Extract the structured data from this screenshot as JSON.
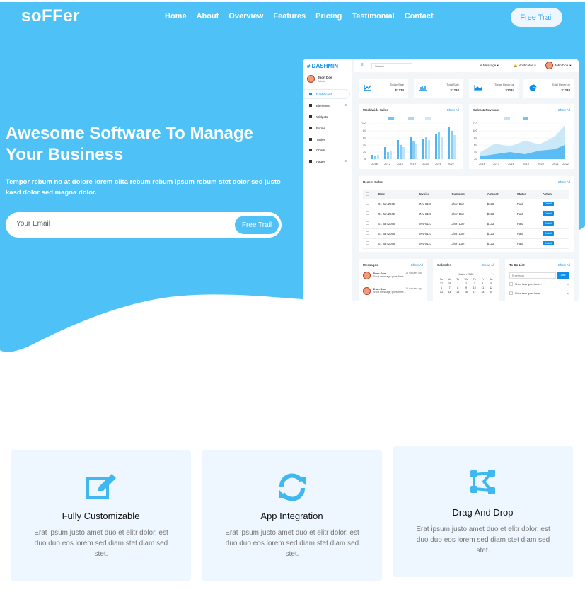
{
  "brand": "soFFer",
  "nav": {
    "items": [
      "Home",
      "About",
      "Overview",
      "Features",
      "Pricing",
      "Testimonial",
      "Contact"
    ],
    "cta": "Free Trail"
  },
  "hero": {
    "title": "Awesome Software To Manage Your Business",
    "subtitle": "Tempor rebum no at dolore lorem clita rebum rebum ipsum rebum stet dolor sed justo kasd dolor sed magna dolor.",
    "email_placeholder": "Your Email",
    "button": "Free Trail"
  },
  "dashboard": {
    "logo": "# DASHMIN",
    "user_name": "Jhon Doe",
    "user_role": "Admin",
    "sidebar": [
      "Dashboard",
      "Elements",
      "Widgets",
      "Forms",
      "Tables",
      "Charts",
      "Pages"
    ],
    "search_placeholder": "Search",
    "top_message": "Message",
    "top_notification": "Notificaton",
    "top_user": "John Doe",
    "stats": [
      {
        "label": "Today Sale",
        "value": "$1234"
      },
      {
        "label": "Total Sale",
        "value": "$1234"
      },
      {
        "label": "Today Revenue",
        "value": "$1234"
      },
      {
        "label": "Total Revenue",
        "value": "$1234"
      }
    ],
    "chart1_title": "Worldwide Sales",
    "chart2_title": "Sales & Revenue",
    "show_all": "Show All",
    "chart1_legend": [
      "USA",
      "UK",
      "AU"
    ],
    "chart2_legend": [
      "Sales",
      "Revenue"
    ],
    "years": [
      "2016",
      "2017",
      "2018",
      "2019",
      "2020",
      "2021",
      "2022"
    ],
    "recent_title": "Recent Salse",
    "table_headers": [
      "Date",
      "Invoice",
      "Customer",
      "Amount",
      "Status",
      "Action"
    ],
    "table_rows": [
      [
        "01 Jan 2045",
        "INV-0123",
        "Jhon Doe",
        "$123",
        "Paid",
        "Detail"
      ],
      [
        "01 Jan 2045",
        "INV-0123",
        "Jhon Doe",
        "$123",
        "Paid",
        "Detail"
      ],
      [
        "01 Jan 2045",
        "INV-0123",
        "Jhon Doe",
        "$123",
        "Paid",
        "Detail"
      ],
      [
        "01 Jan 2045",
        "INV-0123",
        "Jhon Doe",
        "$123",
        "Paid",
        "Detail"
      ],
      [
        "01 Jan 2045",
        "INV-0123",
        "Jhon Doe",
        "$123",
        "Paid",
        "Detail"
      ]
    ],
    "messages_title": "Messages",
    "messages": [
      {
        "name": "Jhon Doe",
        "time": "15 minutes ago",
        "text": "Short message goes here..."
      },
      {
        "name": "Jhon Doe",
        "time": "15 minutes ago",
        "text": "Short message goes here..."
      }
    ],
    "calendar_title": "Calender",
    "calendar_month": "March 2022",
    "calendar_days": [
      "Su",
      "Mo",
      "Tu",
      "We",
      "Th",
      "Fr",
      "Sa"
    ],
    "calendar_rows": [
      [
        "27",
        "28",
        "1",
        "2",
        "3",
        "4",
        "5"
      ],
      [
        "6",
        "7",
        "8",
        "9",
        "10",
        "11",
        "12"
      ],
      [
        "13",
        "14",
        "15",
        "16",
        "17",
        "18",
        "19"
      ]
    ],
    "todo_title": "To Do List",
    "todo_placeholder": "Enter task",
    "todo_add": "Add",
    "todo_items": [
      "Short task goes here...",
      "Short task goes here..."
    ]
  },
  "features": [
    {
      "title": "Fully Customizable",
      "text": "Erat ipsum justo amet duo et elitr dolor, est duo duo eos lorem sed diam stet diam sed stet.",
      "icon": "edit-icon"
    },
    {
      "title": "App Integration",
      "text": "Erat ipsum justo amet duo et elitr dolor, est duo duo eos lorem sed diam stet diam sed stet.",
      "icon": "sync-icon"
    },
    {
      "title": "Drag And Drop",
      "text": "Erat ipsum justo amet duo et elitr dolor, est duo duo eos lorem sed diam stet diam sed stet.",
      "icon": "vector-square-icon"
    }
  ],
  "colors": {
    "primary": "#4ec2f7",
    "accent": "#0d8ee9",
    "card_bg": "#eef6ff"
  }
}
